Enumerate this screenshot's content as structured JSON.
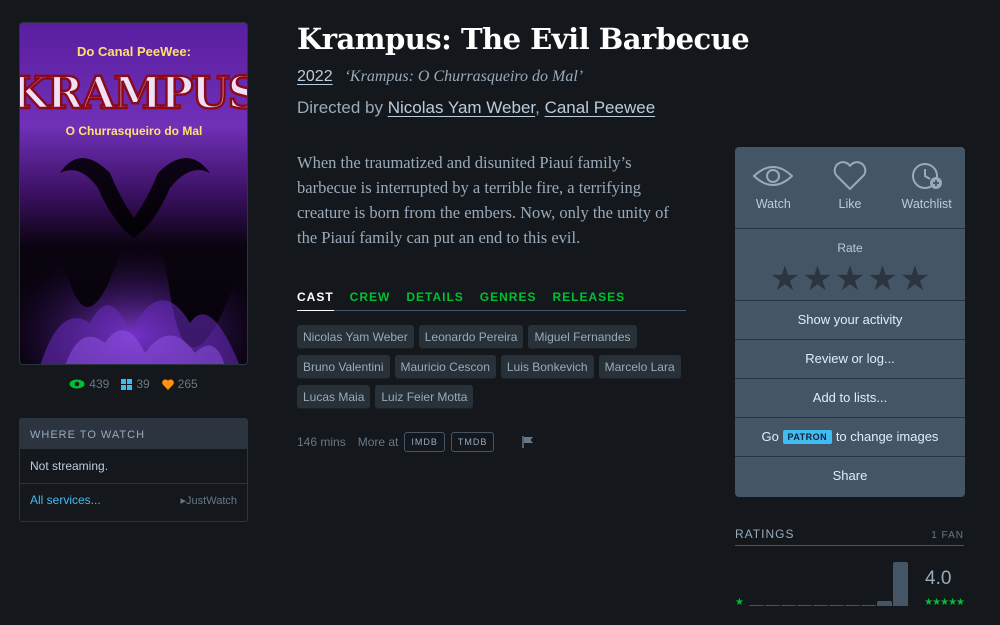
{
  "poster": {
    "top_text": "Do Canal PeeWee:",
    "logo_text": "KRAMPUS",
    "sub_text": "O Churrasqueiro do Mal"
  },
  "stats": {
    "watched": "439",
    "lists": "39",
    "likes": "265"
  },
  "where_to_watch": {
    "heading": "WHERE TO WATCH",
    "status": "Not streaming.",
    "all_services": "All services...",
    "provider": "JustWatch"
  },
  "film": {
    "title": "Krampus: The Evil Barbecue",
    "year": "2022",
    "original_title": "‘Krampus: O Churrasqueiro do Mal’",
    "directed_by_label": "Directed by",
    "directors": [
      "Nicolas Yam Weber",
      "Canal Peewee"
    ],
    "synopsis": "When the traumatized and disunited Piauí family’s barbecue is interrupted by a terrible fire, a terrifying creature is born from the embers. Now, only the unity of the Piauí family can put an end to this evil."
  },
  "tabs": [
    "CAST",
    "CREW",
    "DETAILS",
    "GENRES",
    "RELEASES"
  ],
  "cast": [
    "Nicolas Yam Weber",
    "Leonardo Pereira",
    "Miguel Fernandes",
    "Bruno Valentini",
    "Mauricio Cescon",
    "Luis Bonkevich",
    "Marcelo Lara",
    "Lucas Maia",
    "Luiz Feier Motta"
  ],
  "details": {
    "runtime": "146 mins",
    "more_at": "More at",
    "imdb": "IMDB",
    "tmdb": "TMDB"
  },
  "actions": {
    "watch": "Watch",
    "like": "Like",
    "watchlist": "Watchlist",
    "rate": "Rate",
    "show_activity": "Show your activity",
    "review": "Review or log...",
    "add_lists": "Add to lists...",
    "go": "Go",
    "patron": "PATRON",
    "change_images": "to change images",
    "share": "Share"
  },
  "ratings": {
    "heading": "RATINGS",
    "fans": "1 FAN",
    "average": "4.0",
    "histogram": [
      0,
      0,
      0,
      0,
      0,
      0,
      0,
      0,
      1,
      9
    ]
  },
  "colors": {
    "accent_green": "#00c030",
    "link_blue": "#40bcf4",
    "like_orange": "#ff9010",
    "background": "#14181c"
  }
}
